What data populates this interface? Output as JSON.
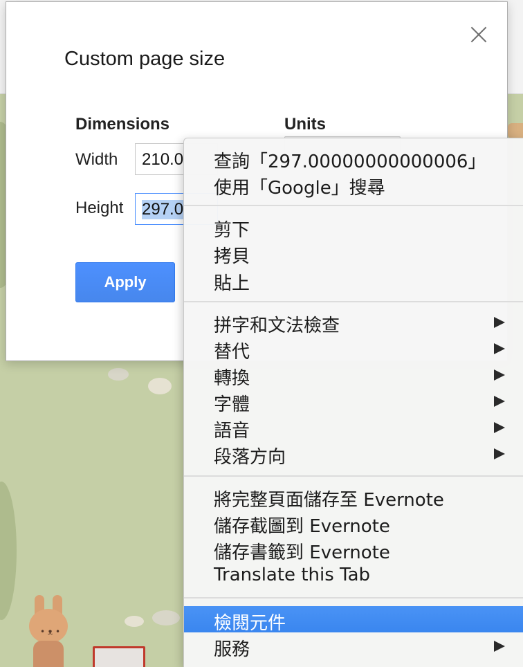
{
  "dialog": {
    "title": "Custom page size",
    "dimensions_heading": "Dimensions",
    "units_heading": "Units",
    "width_label": "Width",
    "width_value": "210.0",
    "height_label": "Height",
    "height_value": "297.0",
    "apply_label": "Apply"
  },
  "context_menu": {
    "group1": {
      "lookup": "查詢「297.00000000000006」",
      "search_google": "使用「Google」搜尋"
    },
    "group2": {
      "cut": "剪下",
      "copy": "拷貝",
      "paste": "貼上"
    },
    "group3": {
      "spelling_grammar": "拼字和文法檢查",
      "substitutions": "替代",
      "transformations": "轉換",
      "font": "字體",
      "speech": "語音",
      "paragraph_direction": "段落方向"
    },
    "group4": {
      "evernote_full_page": "將完整頁面儲存至 Evernote",
      "evernote_screenshot": "儲存截圖到 Evernote",
      "evernote_bookmark": "儲存書籤到 Evernote",
      "translate_tab": "Translate this Tab"
    },
    "group5": {
      "inspect_element": "檢閱元件",
      "services": "服務"
    },
    "highlighted_item": "inspect_element"
  },
  "colors": {
    "accent": "#4c8bf5",
    "menu_highlight": "#3f8ef3",
    "selection": "#b5d1f5"
  }
}
